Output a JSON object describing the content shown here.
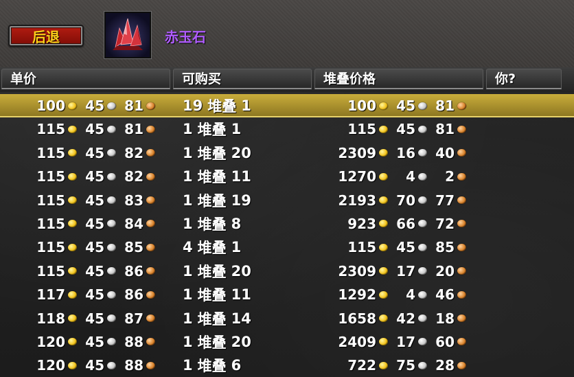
{
  "toolbar": {
    "back_label": "后退"
  },
  "item": {
    "name": "赤玉石",
    "icon": "red-crystal-icon"
  },
  "columns": [
    "单价",
    "可购买",
    "堆叠价格",
    "你?"
  ],
  "stack_word": "堆叠",
  "colors": {
    "item_name": "#b05cff",
    "button_text": "#ffd21a",
    "selected_row": "#c9ad3b"
  },
  "listings": [
    {
      "unit": [
        "100",
        "45",
        "81"
      ],
      "count": "19",
      "stack": "1",
      "total": [
        "100",
        "45",
        "81"
      ],
      "selected": true
    },
    {
      "unit": [
        "115",
        "45",
        "81"
      ],
      "count": "1",
      "stack": "1",
      "total": [
        "115",
        "45",
        "81"
      ]
    },
    {
      "unit": [
        "115",
        "45",
        "82"
      ],
      "count": "1",
      "stack": "20",
      "total": [
        "2309",
        "16",
        "40"
      ]
    },
    {
      "unit": [
        "115",
        "45",
        "82"
      ],
      "count": "1",
      "stack": "11",
      "total": [
        "1270",
        "4",
        "2"
      ]
    },
    {
      "unit": [
        "115",
        "45",
        "83"
      ],
      "count": "1",
      "stack": "19",
      "total": [
        "2193",
        "70",
        "77"
      ]
    },
    {
      "unit": [
        "115",
        "45",
        "84"
      ],
      "count": "1",
      "stack": "8",
      "total": [
        "923",
        "66",
        "72"
      ]
    },
    {
      "unit": [
        "115",
        "45",
        "85"
      ],
      "count": "4",
      "stack": "1",
      "total": [
        "115",
        "45",
        "85"
      ]
    },
    {
      "unit": [
        "115",
        "45",
        "86"
      ],
      "count": "1",
      "stack": "20",
      "total": [
        "2309",
        "17",
        "20"
      ]
    },
    {
      "unit": [
        "117",
        "45",
        "86"
      ],
      "count": "1",
      "stack": "11",
      "total": [
        "1292",
        "4",
        "46"
      ]
    },
    {
      "unit": [
        "118",
        "45",
        "87"
      ],
      "count": "1",
      "stack": "14",
      "total": [
        "1658",
        "42",
        "18"
      ]
    },
    {
      "unit": [
        "120",
        "45",
        "88"
      ],
      "count": "1",
      "stack": "20",
      "total": [
        "2409",
        "17",
        "60"
      ]
    },
    {
      "unit": [
        "120",
        "45",
        "88"
      ],
      "count": "1",
      "stack": "6",
      "total": [
        "722",
        "75",
        "28"
      ]
    }
  ]
}
